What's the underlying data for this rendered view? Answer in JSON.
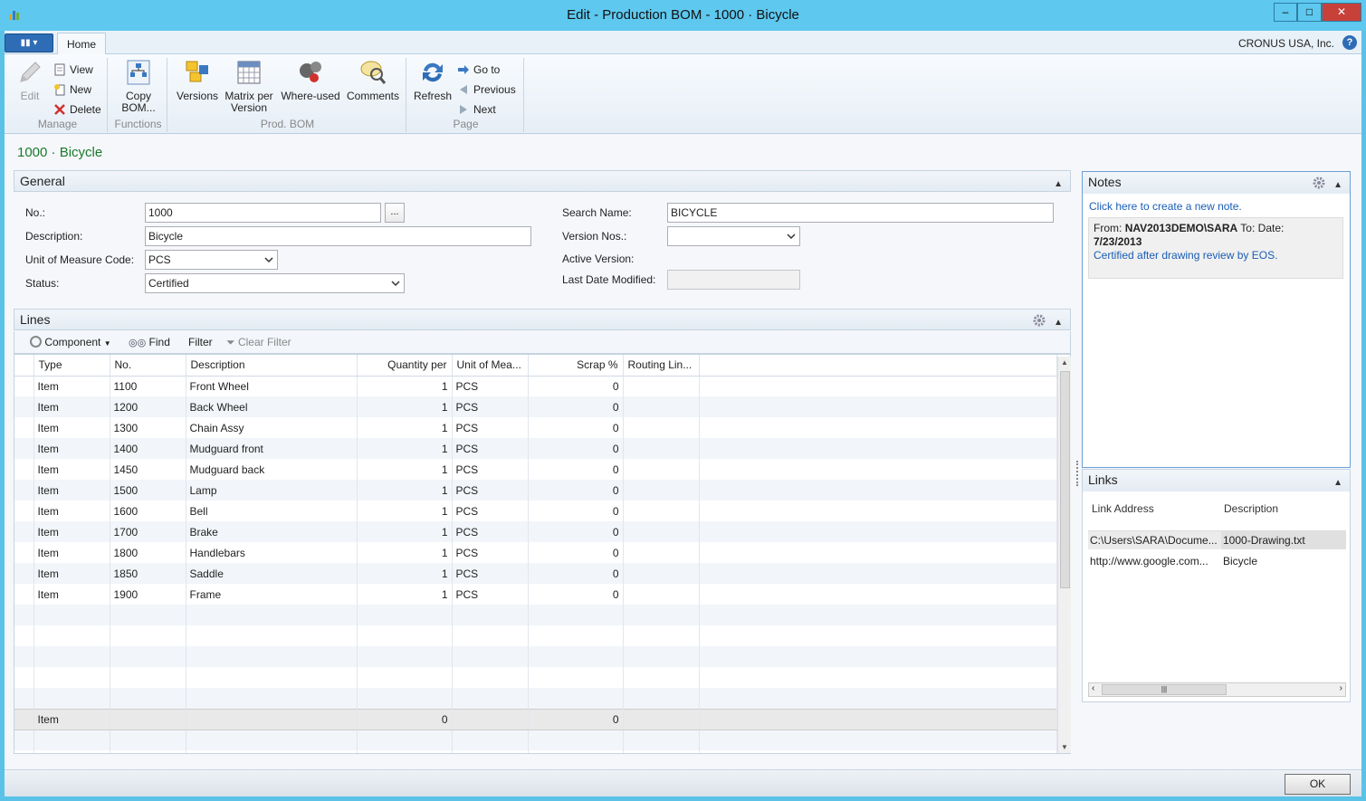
{
  "window": {
    "title": "Edit - Production BOM - 1000 · Bicycle",
    "min_label": "–",
    "max_label": "□",
    "close_label": "✕"
  },
  "ribbon": {
    "home_tab": "Home",
    "company": "CRONUS USA, Inc.",
    "help": "?",
    "manage": {
      "label": "Manage",
      "edit": "Edit",
      "view": "View",
      "new": "New",
      "delete": "Delete"
    },
    "functions": {
      "label": "Functions",
      "copy_bom_1": "Copy",
      "copy_bom_2": "BOM..."
    },
    "prod_bom": {
      "label": "Prod. BOM",
      "versions": "Versions",
      "matrix_1": "Matrix per",
      "matrix_2": "Version",
      "where_used": "Where-used",
      "comments": "Comments"
    },
    "page": {
      "label": "Page",
      "refresh": "Refresh",
      "goto": "Go to",
      "previous": "Previous",
      "next": "Next"
    }
  },
  "caption": "1000 · Bicycle",
  "general": {
    "title": "General",
    "no_label": "No.:",
    "no_value": "1000",
    "assist": "...",
    "description_label": "Description:",
    "description_value": "Bicycle",
    "uom_label": "Unit of Measure Code:",
    "uom_value": "PCS",
    "status_label": "Status:",
    "status_value": "Certified",
    "search_name_label": "Search Name:",
    "search_name_value": "BICYCLE",
    "version_nos_label": "Version Nos.:",
    "version_nos_value": "",
    "active_version_label": "Active Version:",
    "last_date_label": "Last Date Modified:",
    "last_date_value": ""
  },
  "lines": {
    "title": "Lines",
    "toolbar": {
      "component": "Component",
      "find": "Find",
      "filter": "Filter",
      "clear_filter": "Clear Filter"
    },
    "columns": [
      "Type",
      "No.",
      "Description",
      "Quantity per",
      "Unit of Mea...",
      "Scrap %",
      "Routing Lin..."
    ],
    "rows": [
      [
        "Item",
        "1100",
        "Front Wheel",
        "1",
        "PCS",
        "0",
        ""
      ],
      [
        "Item",
        "1200",
        "Back Wheel",
        "1",
        "PCS",
        "0",
        ""
      ],
      [
        "Item",
        "1300",
        "Chain Assy",
        "1",
        "PCS",
        "0",
        ""
      ],
      [
        "Item",
        "1400",
        "Mudguard front",
        "1",
        "PCS",
        "0",
        ""
      ],
      [
        "Item",
        "1450",
        "Mudguard back",
        "1",
        "PCS",
        "0",
        ""
      ],
      [
        "Item",
        "1500",
        "Lamp",
        "1",
        "PCS",
        "0",
        ""
      ],
      [
        "Item",
        "1600",
        "Bell",
        "1",
        "PCS",
        "0",
        ""
      ],
      [
        "Item",
        "1700",
        "Brake",
        "1",
        "PCS",
        "0",
        ""
      ],
      [
        "Item",
        "1800",
        "Handlebars",
        "1",
        "PCS",
        "0",
        ""
      ],
      [
        "Item",
        "1850",
        "Saddle",
        "1",
        "PCS",
        "0",
        ""
      ],
      [
        "Item",
        "1900",
        "Frame",
        "1",
        "PCS",
        "0",
        ""
      ]
    ],
    "new_row": [
      "Item",
      "",
      "",
      "0",
      "",
      "0",
      ""
    ]
  },
  "notes": {
    "title": "Notes",
    "create_link": "Click here to create a new note.",
    "from_label": "From:",
    "from_value": "NAV2013DEMO\\SARA",
    "to_label": "To:",
    "date_label": "Date:",
    "date_value": "7/23/2013",
    "text": "Certified after drawing review by EOS."
  },
  "links": {
    "title": "Links",
    "col_address": "Link Address",
    "col_description": "Description",
    "rows": [
      [
        "C:\\Users\\SARA\\Docume...",
        "1000-Drawing.txt"
      ],
      [
        "http://www.google.com...",
        "Bicycle"
      ]
    ]
  },
  "footer": {
    "ok": "OK"
  },
  "colors": {
    "titlebar": "#5ec8ef",
    "caption": "#1b7a2a",
    "link": "#1a5db5",
    "close": "#c7403a"
  }
}
